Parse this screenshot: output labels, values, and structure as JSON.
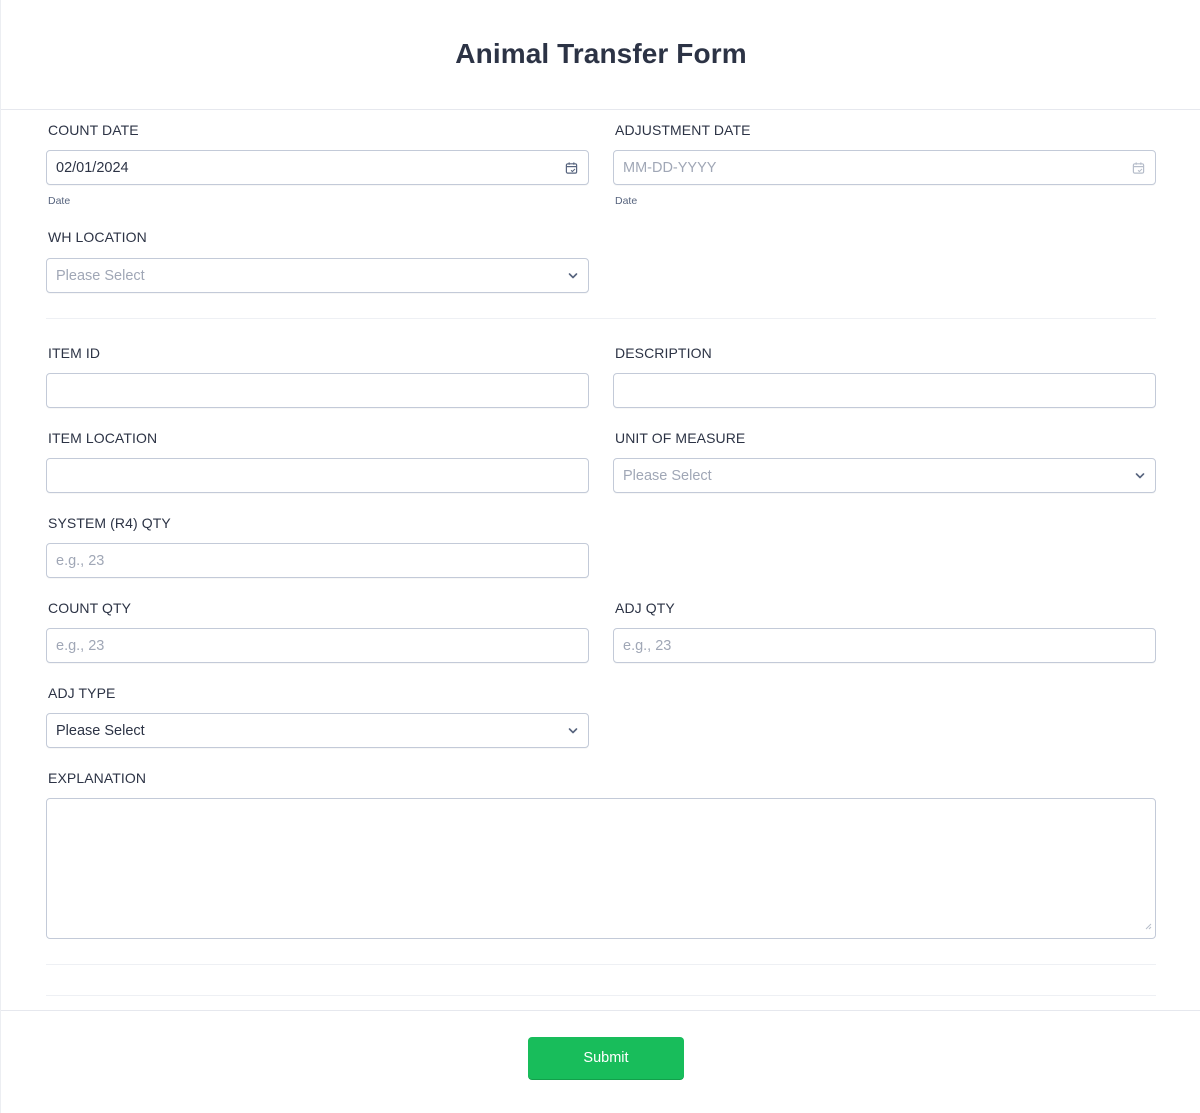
{
  "header": {
    "title": "Animal Transfer Form"
  },
  "fields": {
    "count_date": {
      "label": "COUNT DATE",
      "value": "02/01/2024",
      "sublabel": "Date",
      "icon": "calendar-icon"
    },
    "adjustment_date": {
      "label": "ADJUSTMENT DATE",
      "placeholder": "MM-DD-YYYY",
      "sublabel": "Date",
      "icon": "calendar-icon"
    },
    "wh_location": {
      "label": "WH LOCATION",
      "placeholder": "Please Select",
      "icon": "chevron-down-icon"
    },
    "item_id": {
      "label": "ITEM ID",
      "value": ""
    },
    "description": {
      "label": "DESCRIPTION",
      "value": ""
    },
    "item_location": {
      "label": "ITEM LOCATION",
      "value": ""
    },
    "unit_of_measure": {
      "label": "UNIT OF MEASURE",
      "placeholder": "Please Select",
      "icon": "chevron-down-icon"
    },
    "system_qty": {
      "label": "SYSTEM (R4) QTY",
      "placeholder": "e.g., 23"
    },
    "count_qty": {
      "label": "COUNT QTY",
      "placeholder": "e.g., 23"
    },
    "adj_qty": {
      "label": "ADJ QTY",
      "placeholder": "e.g., 23"
    },
    "adj_type": {
      "label": "ADJ TYPE",
      "value": "Please Select",
      "icon": "chevron-down-icon"
    },
    "explanation": {
      "label": "EXPLANATION",
      "value": ""
    }
  },
  "footer": {
    "submit_label": "Submit"
  },
  "colors": {
    "accent": "#18bd5b",
    "text": "#2c3345",
    "placeholder": "#a0a7b6",
    "border": "#c3cad8"
  }
}
